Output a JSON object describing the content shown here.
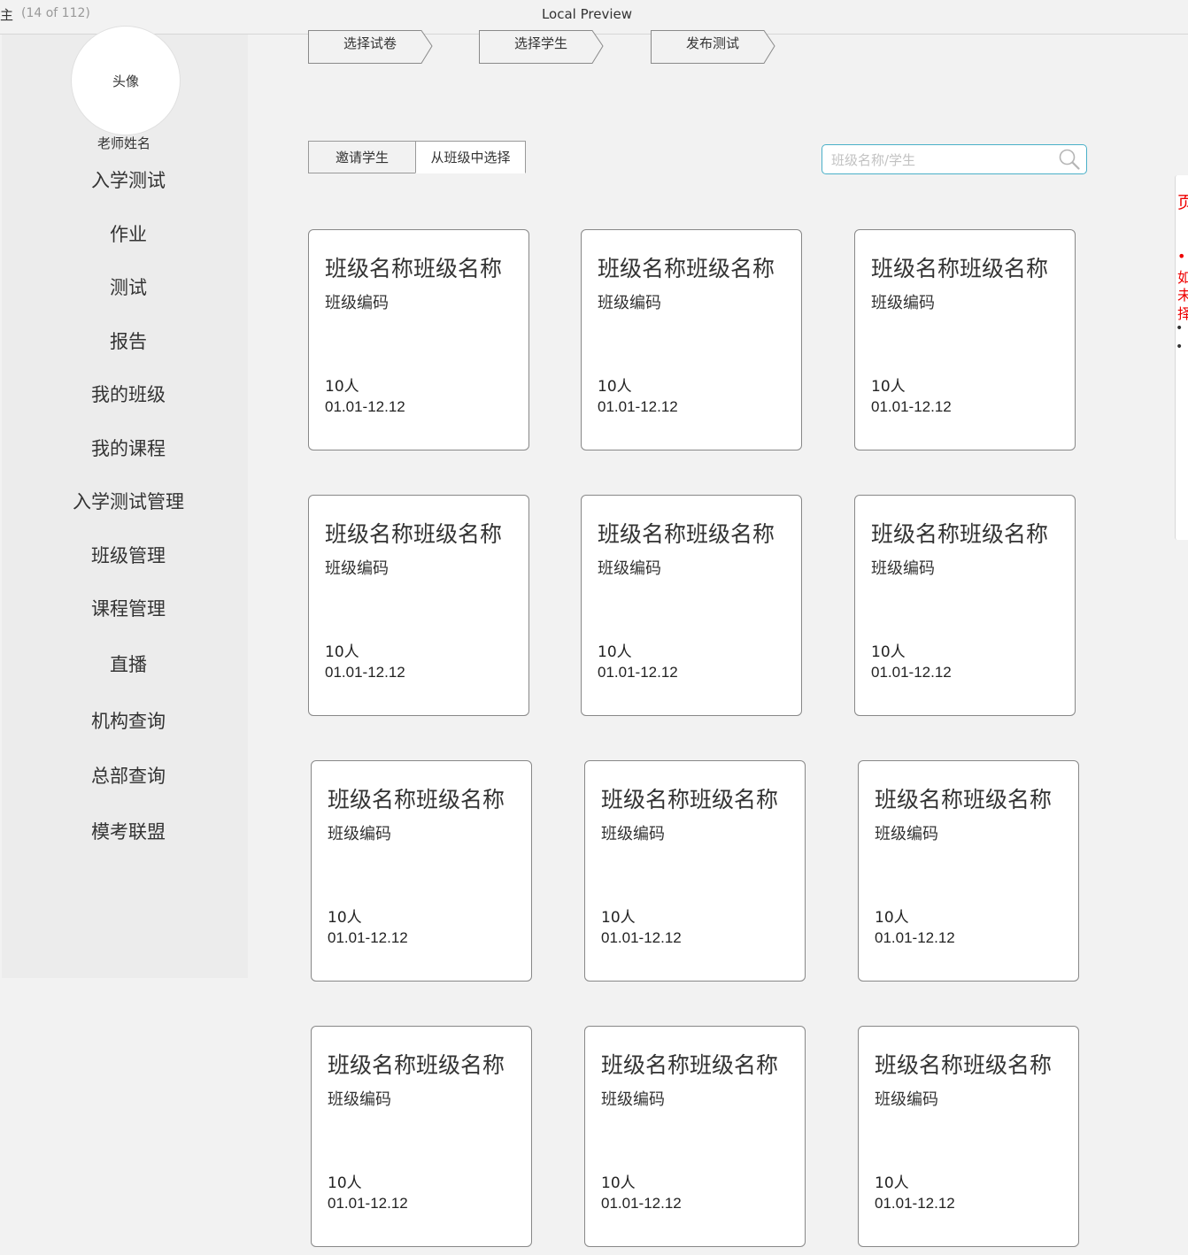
{
  "window": {
    "title_fragment": "主",
    "page_indicator": "(14 of 112)",
    "title": "Local Preview"
  },
  "sidebar": {
    "avatar_label": "头像",
    "teacher_name": "老师姓名",
    "items": [
      {
        "label": "入学测试"
      },
      {
        "label": "作业"
      },
      {
        "label": "测试"
      },
      {
        "label": "报告"
      },
      {
        "label": "我的班级"
      },
      {
        "label": "我的课程"
      },
      {
        "label": "入学测试管理"
      },
      {
        "label": "班级管理"
      },
      {
        "label": "课程管理"
      },
      {
        "label": "直播"
      },
      {
        "label": "机构查询"
      },
      {
        "label": "总部查询"
      },
      {
        "label": "模考联盟"
      }
    ]
  },
  "steps": [
    {
      "label": "选择试卷"
    },
    {
      "label": "选择学生"
    },
    {
      "label": "发布测试"
    }
  ],
  "tabs": [
    {
      "label": "邀请学生"
    },
    {
      "label": "从班级中选择",
      "active": true
    }
  ],
  "search": {
    "placeholder": "班级名称/学生",
    "value": "",
    "icon": "search-icon",
    "border_color": "#4ab0c8"
  },
  "cards": [
    {
      "name": "班级名称班级名称",
      "code": "班级编码",
      "count": "10人",
      "dates": "01.01-12.12"
    },
    {
      "name": "班级名称班级名称",
      "code": "班级编码",
      "count": "10人",
      "dates": "01.01-12.12"
    },
    {
      "name": "班级名称班级名称",
      "code": "班级编码",
      "count": "10人",
      "dates": "01.01-12.12"
    },
    {
      "name": "班级名称班级名称",
      "code": "班级编码",
      "count": "10人",
      "dates": "01.01-12.12"
    },
    {
      "name": "班级名称班级名称",
      "code": "班级编码",
      "count": "10人",
      "dates": "01.01-12.12"
    },
    {
      "name": "班级名称班级名称",
      "code": "班级编码",
      "count": "10人",
      "dates": "01.01-12.12"
    },
    {
      "name": "班级名称班级名称",
      "code": "班级编码",
      "count": "10人",
      "dates": "01.01-12.12"
    },
    {
      "name": "班级名称班级名称",
      "code": "班级编码",
      "count": "10人",
      "dates": "01.01-12.12"
    },
    {
      "name": "班级名称班级名称",
      "code": "班级编码",
      "count": "10人",
      "dates": "01.01-12.12"
    },
    {
      "name": "班级名称班级名称",
      "code": "班级编码",
      "count": "10人",
      "dates": "01.01-12.12"
    },
    {
      "name": "班级名称班级名称",
      "code": "班级编码",
      "count": "10人",
      "dates": "01.01-12.12"
    },
    {
      "name": "班级名称班级名称",
      "code": "班级编码",
      "count": "10人",
      "dates": "01.01-12.12"
    }
  ],
  "side_note": {
    "title": "页",
    "lines": [
      "• ",
      "如",
      "未",
      "择"
    ],
    "bullets": [
      "• ",
      "• "
    ],
    "text_color": "#e00000"
  }
}
